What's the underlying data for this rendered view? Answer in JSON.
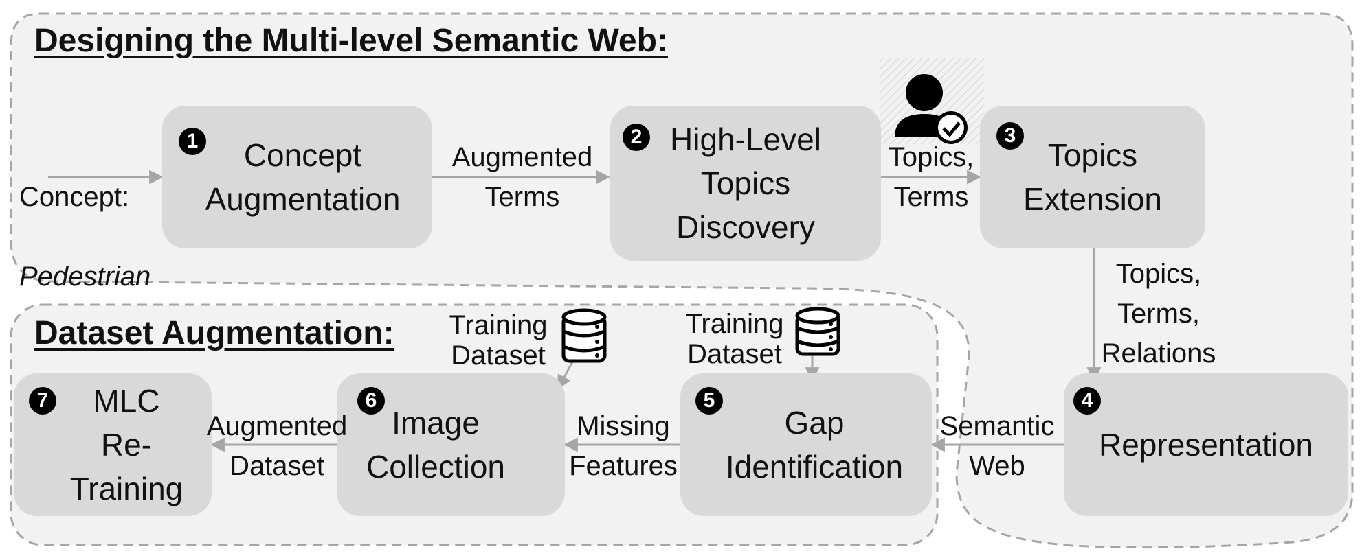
{
  "titles": {
    "top": "Designing the Multi-level Semantic Web:",
    "bottom": "Dataset Augmentation:"
  },
  "input": {
    "label": "Concept:",
    "value": "Pedestrian"
  },
  "steps": [
    {
      "num": "1",
      "label": "Concept\nAugmentation"
    },
    {
      "num": "2",
      "label": "High-Level\nTopics\nDiscovery"
    },
    {
      "num": "3",
      "label": "Topics\nExtension"
    },
    {
      "num": "4",
      "label": "Representation"
    },
    {
      "num": "5",
      "label": "Gap\nIdentification"
    },
    {
      "num": "6",
      "label": "Image\nCollection"
    },
    {
      "num": "7",
      "label": "MLC\nRe-\nTraining"
    }
  ],
  "edge_labels": {
    "e1_2": "Augmented\nTerms",
    "e2_3": "Topics,\nTerms",
    "e3_4": "Topics,\nTerms,\nRelations",
    "e4_5": "Semantic\nWeb",
    "e5_6": "Missing\nFeatures",
    "e6_7": "Augmented\nDataset"
  },
  "dataset_labels": {
    "d5": "Training\nDataset",
    "d6": "Training\nDataset"
  },
  "icons": [
    "user-check-icon",
    "user-icon",
    "database-icon"
  ],
  "colors": {
    "box": "#d9d9d9",
    "region": "#f2f2f2",
    "dash": "#a6a6a6",
    "arrow": "#a6a6a6",
    "badge": "#000000"
  }
}
